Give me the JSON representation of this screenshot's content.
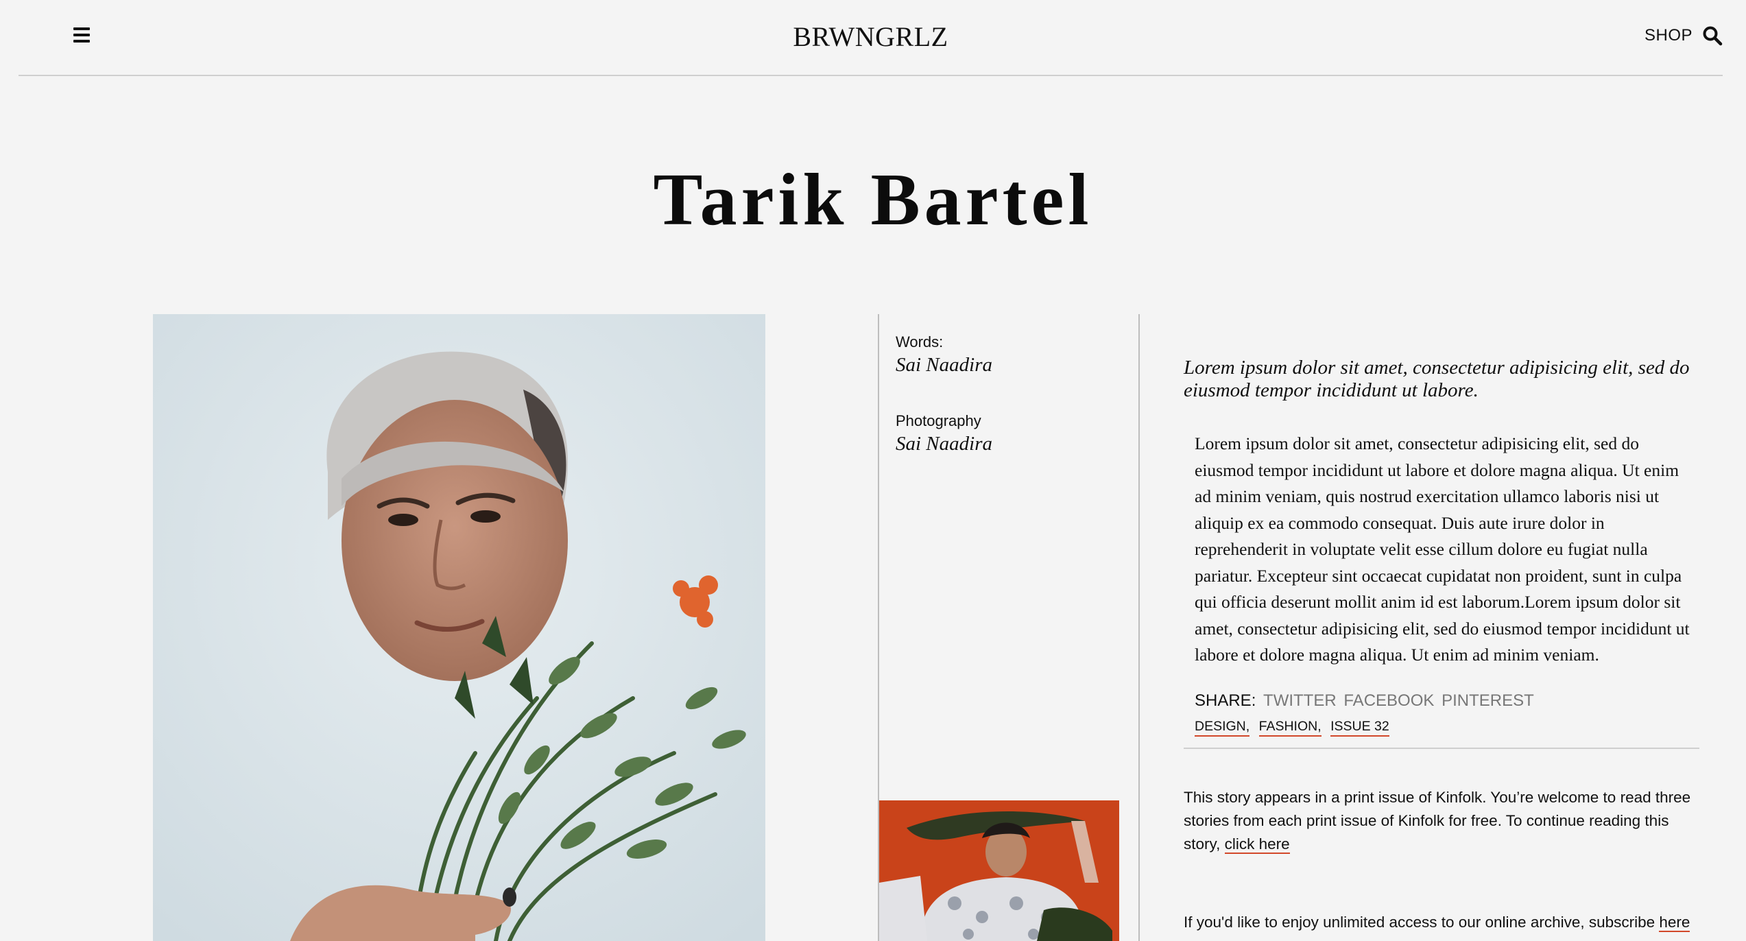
{
  "header": {
    "logo": "BRWNGRLZ",
    "shop_label": "SHOP",
    "menu_icon": "hamburger-menu-icon",
    "search_icon": "search-icon"
  },
  "article": {
    "title": "Tarik Bartel",
    "credits": [
      {
        "label": "Words:",
        "name": "Sai Naadira"
      },
      {
        "label": "Photography",
        "name": "Sai Naadira"
      }
    ],
    "lede": "Lorem ipsum dolor sit amet, consectetur adipisicing elit, sed do eiusmod tempor incididunt ut labore.",
    "body": "Lorem ipsum dolor sit amet, consectetur adipisicing elit, sed do eiusmod tempor incididunt ut labore et dolore magna aliqua. Ut enim ad minim veniam, quis nostrud exercitation ullamco laboris nisi ut aliquip ex ea commodo consequat. Duis aute irure dolor in reprehenderit in voluptate velit esse cillum dolore eu fugiat nulla pariatur. Excepteur sint occaecat cupidatat non proident, sunt in culpa qui officia deserunt mollit anim id est laborum.Lorem ipsum dolor sit amet, consectetur adipisicing elit, sed do eiusmod tempor incididunt ut labore et dolore magna aliqua. Ut enim ad minim veniam.",
    "share": {
      "label": "SHARE:",
      "links": [
        "TWITTER",
        "FACEBOOK",
        "PINTEREST"
      ]
    },
    "tags": [
      "DESIGN,",
      "FASHION,",
      "ISSUE 32"
    ],
    "note": {
      "text": "This story appears in a print issue of Kinfolk. You’re welcome to read three stories from each print issue of Kinfolk for free. To continue reading this story, ",
      "link": "click here"
    },
    "note2": {
      "text": "If you'd like to enjoy unlimited access to our online archive, subscribe ",
      "link": "here"
    }
  },
  "colors": {
    "background": "#f4f4f4",
    "accent_underline": "#d2482a",
    "share_link": "#777777",
    "thumb_background": "#c9431a"
  }
}
